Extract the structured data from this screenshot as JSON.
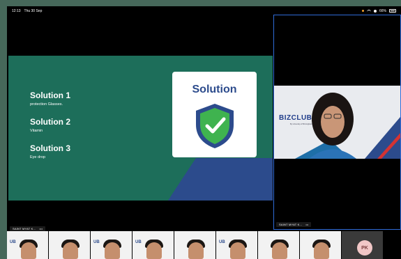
{
  "status_bar": {
    "time": "12:13",
    "date": "Thu 30 Sep",
    "battery": "66%"
  },
  "slide": {
    "solutions": [
      {
        "title": "Solution 1",
        "desc": "protection Glasses."
      },
      {
        "title": "Solution 2",
        "desc": "Vitamin"
      },
      {
        "title": "Solution 3",
        "desc": "Eye drop"
      }
    ],
    "card_title": "Solution",
    "colors": {
      "background": "#1d6e5a",
      "accent": "#2c4b8c",
      "shield_green": "#3fb34f"
    }
  },
  "share_tile": {
    "participant_name": "SAINT MYAT K...",
    "more": "•••"
  },
  "speaker_tile": {
    "participant_name": "SAINT MYAT K...",
    "background_brand": "BIZCLUB",
    "background_sub": "By University of Birmingham"
  },
  "thumbnails": [
    {
      "logo": "UB"
    },
    {
      "logo": ""
    },
    {
      "logo": "UB"
    },
    {
      "logo": "UB"
    },
    {
      "logo": ""
    },
    {
      "logo": "UB"
    },
    {
      "logo": ""
    },
    {
      "logo": ""
    },
    {
      "avatar_initials": "PK"
    }
  ]
}
